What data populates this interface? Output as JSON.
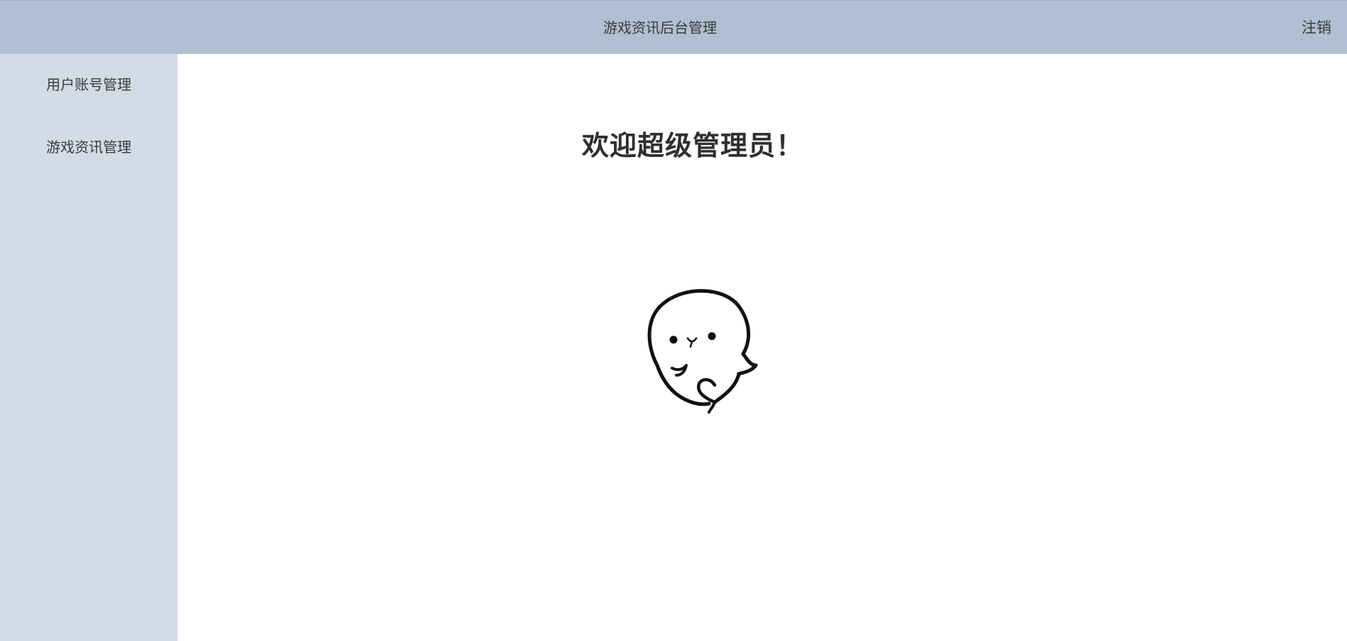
{
  "header": {
    "title": "游戏资讯后台管理",
    "logout_label": "注销"
  },
  "sidebar": {
    "items": [
      {
        "label": "用户账号管理"
      },
      {
        "label": "游戏资讯管理"
      }
    ]
  },
  "main": {
    "welcome_text": "欢迎超级管理员！",
    "mascot_icon": "ghost-doodle-icon"
  },
  "colors": {
    "header_bg": "#b0bfd1",
    "sidebar_bg": "#d3dbe6",
    "main_bg": "#ffffff"
  }
}
